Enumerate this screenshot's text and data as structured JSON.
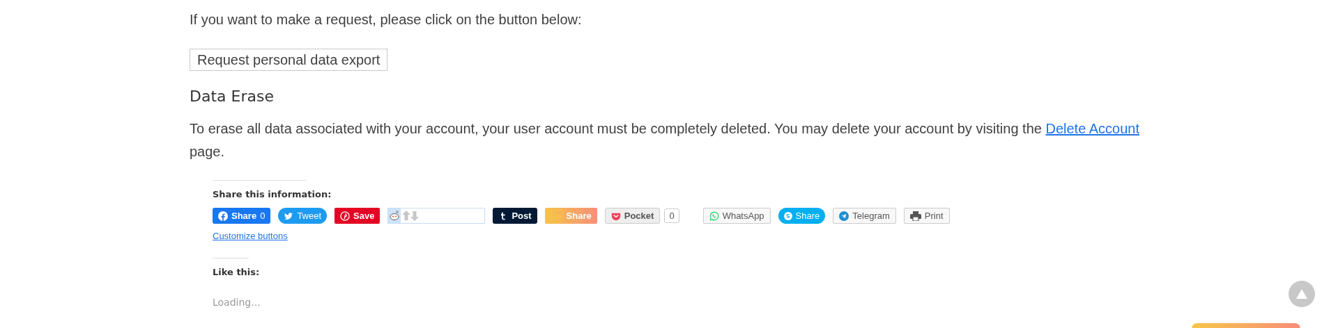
{
  "intro": "If you want to make a request, please click on the button below:",
  "export_button": "Request personal data export",
  "heading": "Data Erase",
  "paragraph": {
    "before": "To erase all data associated with your account, your user account must be completely deleted. You may delete your account by visiting the ",
    "link": "Delete Account",
    "after": " page."
  },
  "share": {
    "title": "Share this information:",
    "buttons": [
      {
        "kind": "facebook",
        "label": "Share",
        "count": "0"
      },
      {
        "kind": "twitter",
        "label": "Tweet"
      },
      {
        "kind": "pinterest",
        "label": "Save"
      },
      {
        "kind": "reddit"
      },
      {
        "kind": "tumblr",
        "label": "Post"
      },
      {
        "kind": "linkedin",
        "label": "Share"
      },
      {
        "kind": "pocket",
        "label": "Pocket",
        "count": "0"
      },
      {
        "kind": "whatsapp",
        "label": "WhatsApp"
      },
      {
        "kind": "skype",
        "label": "Share"
      },
      {
        "kind": "telegram",
        "label": "Telegram"
      },
      {
        "kind": "print",
        "label": "Print"
      }
    ],
    "customize": "Customize buttons"
  },
  "like": {
    "title": "Like this:",
    "status": "Loading..."
  }
}
